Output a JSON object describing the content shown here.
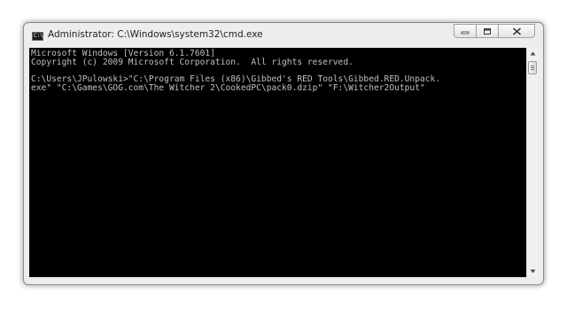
{
  "window": {
    "title": "Administrator: C:\\Windows\\system32\\cmd.exe",
    "icon": "console-app-icon",
    "icon_text": "C:\\"
  },
  "caption_buttons": [
    {
      "name": "minimize",
      "icon": "minimize-icon"
    },
    {
      "name": "maximize",
      "icon": "maximize-icon"
    },
    {
      "name": "close",
      "icon": "close-icon"
    }
  ],
  "console": {
    "lines": [
      "Microsoft Windows [Version 6.1.7601]",
      "Copyright (c) 2009 Microsoft Corporation.  All rights reserved.",
      "",
      "C:\\Users\\JPulowski>\"C:\\Program Files (x86)\\Gibbed's RED Tools\\Gibbed.RED.Unpack.",
      "exe\" \"C:\\Games\\GOG.com\\The Witcher 2\\CookedPC\\pack0.dzip\" \"F:\\Witcher2Output\""
    ],
    "background": "#000000",
    "text_color": "#c0c0c0"
  },
  "scrollbar": {
    "up_icon": "scroll-up-arrow-icon",
    "down_icon": "scroll-down-arrow-icon"
  }
}
